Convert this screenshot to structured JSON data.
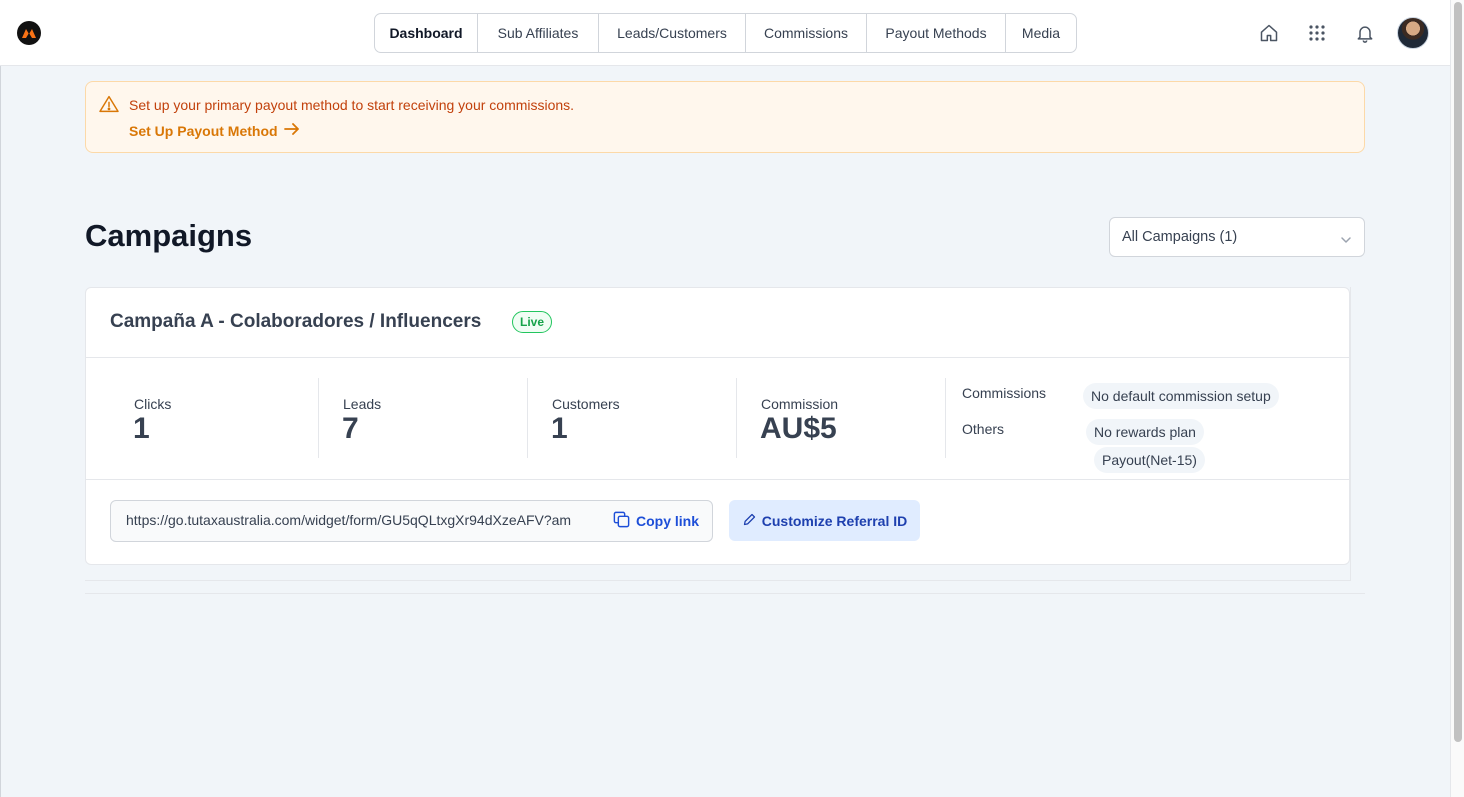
{
  "nav": {
    "items": [
      {
        "label": "Dashboard",
        "active": true
      },
      {
        "label": "Sub Affiliates",
        "active": false
      },
      {
        "label": "Leads/Customers",
        "active": false
      },
      {
        "label": "Commissions",
        "active": false
      },
      {
        "label": "Payout Methods",
        "active": false
      },
      {
        "label": "Media",
        "active": false
      }
    ]
  },
  "header_icons": [
    "home-icon",
    "apps-grid-icon",
    "bell-icon",
    "avatar"
  ],
  "alert": {
    "message": "Set up your primary payout method to start receiving your commissions.",
    "link_label": "Set Up Payout Method"
  },
  "page": {
    "title": "Campaigns",
    "filter_selected": "All Campaigns (1)"
  },
  "campaign": {
    "name": "Campaña A - Colaboradores / Influencers",
    "status": "Live",
    "stats": [
      {
        "label": "Clicks",
        "value": "1"
      },
      {
        "label": "Leads",
        "value": "7"
      },
      {
        "label": "Customers",
        "value": "1"
      },
      {
        "label": "Commission",
        "value": "AU$5"
      }
    ],
    "commissions_label": "Commissions",
    "commissions_value": "No default commission setup",
    "others_label": "Others",
    "others_values": [
      "No rewards plan",
      "Payout(Net-15)"
    ],
    "referral_link": "https://go.tutaxaustralia.com/widget/form/GU5qQLtxgXr94dXzeAFV?am",
    "copy_label": "Copy link",
    "customize_label": "Customize Referral ID"
  },
  "colors": {
    "accent": "#1d4ed8",
    "alert_text": "#c2410c",
    "alert_link": "#d97706",
    "live": "#16a34a"
  }
}
